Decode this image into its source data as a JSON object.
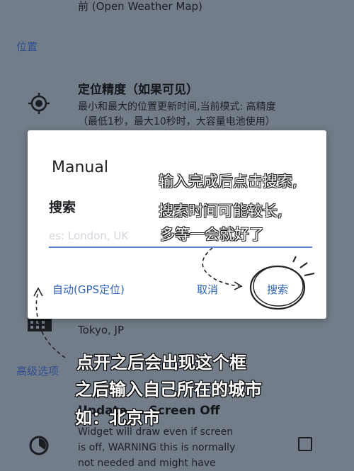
{
  "background": {
    "top_line": "前 (Open Weather Map)",
    "location_section": "位置",
    "accuracy": {
      "title": "定位精度（如果可见）",
      "summary_line1": "最小和最大的位置更新时间,当前模式: 高精度",
      "summary_line2": "（最低1秒，最大10秒时，大容量电池使用）"
    },
    "tokyo_text": "Tokyo, JP",
    "advanced_section": "高级选项",
    "screen_off_title": "Update ... Screen Off",
    "screen_off_summary_line1": "Widget will draw even if screen",
    "screen_off_summary_line2": "is off, WARNING this is normally",
    "screen_off_summary_line3": "not needed and might have"
  },
  "dialog": {
    "title": "Manual",
    "search_label": "搜索",
    "input_placeholder": "es: London, UK",
    "auto_button": "自动(GPS定位)",
    "cancel_button": "取消",
    "search_button": "搜索"
  },
  "annotations": {
    "dialog_note_line1": "输入完成后点击搜索,",
    "dialog_note_line2": "搜索时间可能较长,",
    "dialog_note_line3": "多等一会就好了",
    "main_note_line1": "点开之后会出现这个框",
    "main_note_line2": "之后输入自己所在的城市",
    "main_note_line3": "如：北京市"
  },
  "colors": {
    "accent": "#2f63b8",
    "input_underline": "#5b8bd6",
    "dim_background": "#737d89"
  }
}
